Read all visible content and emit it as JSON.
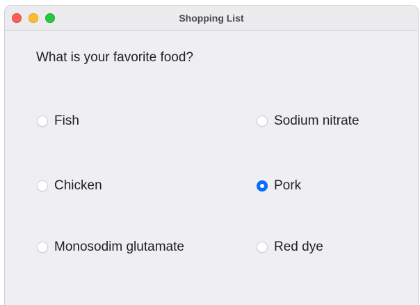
{
  "window": {
    "title": "Shopping List"
  },
  "question": "What is your favorite food?",
  "options": [
    {
      "label": "Fish",
      "selected": false
    },
    {
      "label": "Sodium nitrate",
      "selected": false
    },
    {
      "label": "Chicken",
      "selected": false
    },
    {
      "label": "Pork",
      "selected": true
    },
    {
      "label": "Monosodim glutamate",
      "selected": false
    },
    {
      "label": "Red dye",
      "selected": false
    }
  ],
  "colors": {
    "accent": "#0a6cff",
    "window_background": "#efeff2",
    "close_button": "#ff5f57",
    "minimize_button": "#febc2e",
    "zoom_button": "#28c840"
  }
}
